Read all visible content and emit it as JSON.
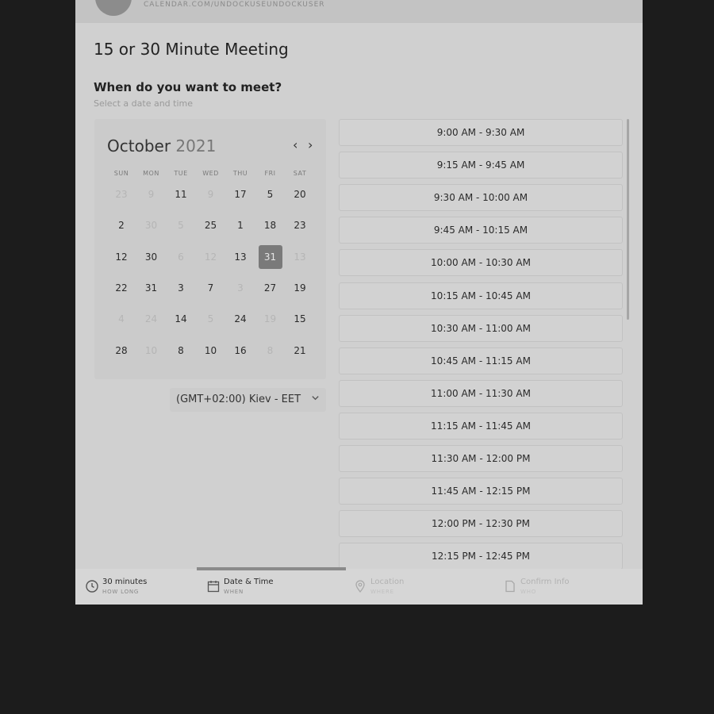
{
  "header": {
    "url": "CALENDAR.COM/UNDOCKUSEUNDOCKUSER"
  },
  "meeting_title": "15 or 30 Minute Meeting",
  "prompt": {
    "heading": "When do you want to meet?",
    "subtext": "Select a date and time"
  },
  "calendar": {
    "month": "October",
    "year": "2021",
    "weekdays": [
      "SUN",
      "MON",
      "TUE",
      "WED",
      "THU",
      "FRI",
      "SAT"
    ],
    "weeks": [
      [
        {
          "d": "23",
          "off": true
        },
        {
          "d": "9",
          "off": true
        },
        {
          "d": "11",
          "off": false
        },
        {
          "d": "9",
          "off": true
        },
        {
          "d": "17",
          "off": false
        },
        {
          "d": "5",
          "off": false
        },
        {
          "d": "20",
          "off": false
        }
      ],
      [
        {
          "d": "2",
          "off": false
        },
        {
          "d": "30",
          "off": true
        },
        {
          "d": "5",
          "off": true
        },
        {
          "d": "25",
          "off": false
        },
        {
          "d": "1",
          "off": false
        },
        {
          "d": "18",
          "off": false
        },
        {
          "d": "23",
          "off": false
        }
      ],
      [
        {
          "d": "12",
          "off": false
        },
        {
          "d": "30",
          "off": false
        },
        {
          "d": "6",
          "off": true
        },
        {
          "d": "12",
          "off": true
        },
        {
          "d": "13",
          "off": false
        },
        {
          "d": "31",
          "off": false,
          "selected": true
        },
        {
          "d": "13",
          "off": true
        }
      ],
      [
        {
          "d": "22",
          "off": false
        },
        {
          "d": "31",
          "off": false
        },
        {
          "d": "3",
          "off": false
        },
        {
          "d": "7",
          "off": false
        },
        {
          "d": "3",
          "off": true
        },
        {
          "d": "27",
          "off": false
        },
        {
          "d": "19",
          "off": false
        }
      ],
      [
        {
          "d": "4",
          "off": true
        },
        {
          "d": "24",
          "off": true
        },
        {
          "d": "14",
          "off": false
        },
        {
          "d": "5",
          "off": true
        },
        {
          "d": "24",
          "off": false
        },
        {
          "d": "19",
          "off": true
        },
        {
          "d": "15",
          "off": false
        }
      ],
      [
        {
          "d": "28",
          "off": false
        },
        {
          "d": "10",
          "off": true
        },
        {
          "d": "8",
          "off": false
        },
        {
          "d": "10",
          "off": false
        },
        {
          "d": "16",
          "off": false
        },
        {
          "d": "8",
          "off": true
        },
        {
          "d": "21",
          "off": false
        }
      ]
    ]
  },
  "timezone": {
    "value": "(GMT+02:00) Kiev - EET",
    "chevron_icon": "chevron-down-icon"
  },
  "time_slots": [
    "9:00 AM - 9:30 AM",
    "9:15 AM - 9:45 AM",
    "9:30 AM - 10:00 AM",
    "9:45 AM - 10:15 AM",
    "10:00 AM - 10:30 AM",
    "10:15 AM - 10:45 AM",
    "10:30 AM - 11:00 AM",
    "10:45 AM - 11:15 AM",
    "11:00 AM - 11:30 AM",
    "11:15 AM - 11:45 AM",
    "11:30 AM - 12:00 PM",
    "11:45 AM - 12:15 PM",
    "12:00 PM - 12:30 PM",
    "12:15 PM - 12:45 PM"
  ],
  "steps": [
    {
      "label": "30 minutes",
      "sub": "HOW LONG",
      "icon": "clock-icon",
      "active": true
    },
    {
      "label": "Date & Time",
      "sub": "WHEN",
      "icon": "calendar-icon",
      "active": true
    },
    {
      "label": "Location",
      "sub": "WHERE",
      "icon": "location-pin-icon",
      "active": false
    },
    {
      "label": "Confirm Info",
      "sub": "WHO",
      "icon": "document-icon",
      "active": false
    }
  ],
  "colors": {
    "selected_day": "#7a7a7a",
    "background": "#1c1c1c",
    "panel": "#d0d0d0"
  }
}
